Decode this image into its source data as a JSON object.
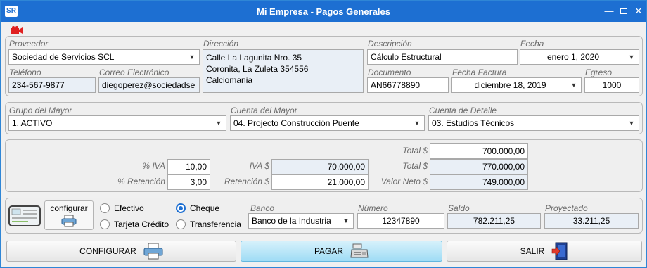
{
  "window": {
    "title": "Mi Empresa - Pagos Generales",
    "logo": "SR"
  },
  "icons": {
    "app": "sr-logo-icon",
    "record": "camera-record-icon",
    "minimize": "minimize-icon",
    "maximize": "maximize-icon",
    "close": "close-icon",
    "printer": "printer-icon",
    "register": "cash-register-icon",
    "exit": "exit-door-icon",
    "check": "bank-check-icon"
  },
  "header": {
    "proveedor_label": "Proveedor",
    "proveedor": "Sociedad de Servicios SCL",
    "direccion_label": "Dirección",
    "direccion": "Calle La Lagunita Nro. 35\nCoronita, La Zuleta 354556\nCalciomania",
    "descripcion_label": "Descripción",
    "descripcion": "Cálculo Estructural",
    "fecha_label": "Fecha",
    "fecha": "enero 1, 2020",
    "telefono_label": "Teléfono",
    "telefono": "234-567-9877",
    "correo_label": "Correo Electrónico",
    "correo": "diegoperez@sociedadse",
    "documento_label": "Documento",
    "documento": "AN66778890",
    "fecha_factura_label": "Fecha Factura",
    "fecha_factura": "diciembre 18, 2019",
    "egreso_label": "Egreso",
    "egreso": "1000"
  },
  "cuentas": {
    "grupo_label": "Grupo del Mayor",
    "grupo": "1. ACTIVO",
    "cuenta_label": "Cuenta del Mayor",
    "cuenta": "04. Projecto Construcción Puente",
    "detalle_label": "Cuenta de Detalle",
    "detalle": "03. Estudios Técnicos"
  },
  "totales": {
    "total1_label": "Total $",
    "total1": "700.000,00",
    "iva_pct_label": "% IVA",
    "iva_pct": "10,00",
    "iva_label": "IVA $",
    "iva": "70.000,00",
    "total2_label": "Total $",
    "total2": "770.000,00",
    "ret_pct_label": "% Retención",
    "ret_pct": "3,00",
    "ret_label": "Retención $",
    "ret": "21.000,00",
    "neto_label": "Valor Neto $",
    "neto": "749.000,00"
  },
  "pago": {
    "configurar": "configurar",
    "efectivo": "Efectivo",
    "cheque": "Cheque",
    "tarjeta": "Tarjeta Crédito",
    "transferencia": "Transferencia",
    "selected_method": "Cheque",
    "banco_label": "Banco",
    "banco": "Banco de la Industria",
    "numero_label": "Número",
    "numero": "12347890",
    "saldo_label": "Saldo",
    "saldo": "782.211,25",
    "proyectado_label": "Proyectado",
    "proyectado": "33.211,25"
  },
  "actions": {
    "configurar": "CONFIGURAR",
    "pagar": "PAGAR",
    "salir": "SALIR"
  },
  "colors": {
    "titlebar": "#1d6fd2",
    "readonly_field": "#e9eff6",
    "primary_button": "#9fdcf5",
    "record_icon": "#e02020"
  }
}
